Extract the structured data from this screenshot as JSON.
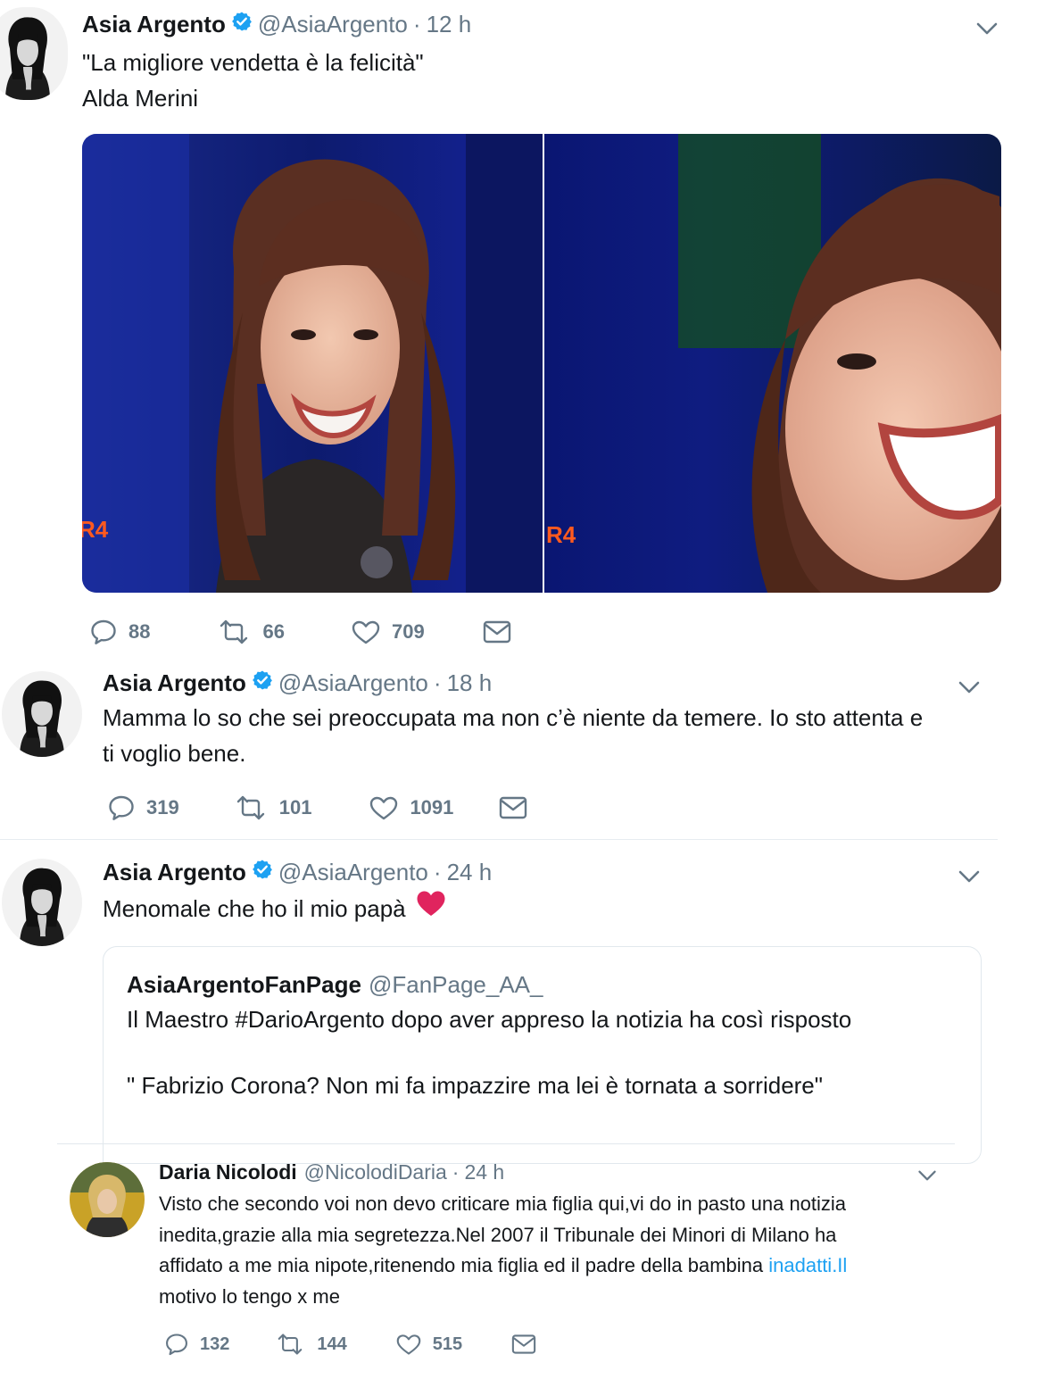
{
  "tweets": [
    {
      "name": "Asia Argento",
      "handle": "@AsiaArgento",
      "dot": "·",
      "time": "12 h",
      "lines": [
        "\"La migliore vendetta è la felicità\"",
        "Alda Merini"
      ],
      "media_bug": [
        "R4",
        "R4"
      ],
      "replies": "88",
      "retweets": "66",
      "likes": "709"
    },
    {
      "name": "Asia Argento",
      "handle": "@AsiaArgento",
      "dot": "·",
      "time": "18 h",
      "lines": [
        "Mamma lo so che sei preoccupata ma non c’è niente da temere. Io sto attenta e",
        "ti voglio bene."
      ],
      "replies": "319",
      "retweets": "101",
      "likes": "1091"
    },
    {
      "name": "Asia Argento",
      "handle": "@AsiaArgento",
      "dot": "·",
      "time": "24 h",
      "text": "Menomale che ho il mio papà",
      "emoji": "heart",
      "quote": {
        "name": "AsiaArgentoFanPage",
        "handle": "@FanPage_AA_",
        "line1": "Il Maestro #DarioArgento dopo aver appreso la notizia ha così risposto",
        "line2": "\" Fabrizio Corona? Non mi fa impazzire ma lei è tornata a sorridere\""
      }
    },
    {
      "name": "Daria Nicolodi",
      "handle": "@NicolodiDaria",
      "dot": "·",
      "time": "24 h",
      "lines": [
        "Visto che secondo voi non devo criticare mia figlia qui,vi do in pasto una notizia",
        "inedita,grazie alla mia segretezza.Nel 2007 il Tribunale dei Minori di Milano ha",
        "affidato a me mia nipote,ritenendo mia figlia ed il padre della bambina "
      ],
      "link": "inadatti.Il",
      "last_line": "motivo lo tengo x me",
      "replies": "132",
      "retweets": "144",
      "likes": "515"
    }
  ],
  "colors": {
    "verified": "#1da1f2",
    "muted": "#657786",
    "link": "#1da1f2",
    "heart": "#e0245e",
    "divider": "#e6ecf0"
  },
  "icons": [
    "reply-icon",
    "retweet-icon",
    "like-icon",
    "dm-icon",
    "chevron-down-icon",
    "verified-badge-icon",
    "red-heart-emoji"
  ]
}
